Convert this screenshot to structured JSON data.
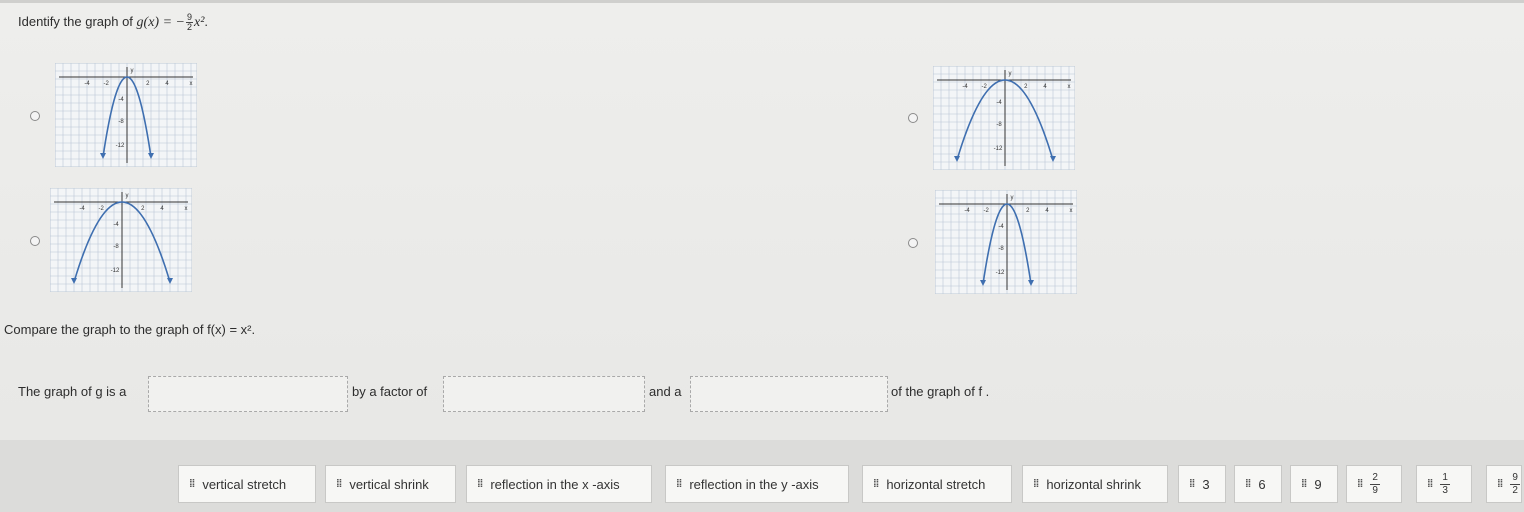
{
  "question1": {
    "prefix": "Identify the graph of ",
    "function_lhs": "g(x) = −",
    "coef_num": "9",
    "coef_den": "2",
    "var": "x²",
    "suffix": "."
  },
  "graph_tick_labels": {
    "x_neg4": "-4",
    "x_neg2": "-2",
    "x_2": "2",
    "x_4": "4",
    "y_neg4": "-4",
    "y_neg8": "-8",
    "y_neg12": "-12",
    "x_axis": "x",
    "y_axis": "y"
  },
  "question2": {
    "text": "Compare the graph to the graph of f(x) = x²."
  },
  "sentence": {
    "part1": "The graph of g is a",
    "part2": "by a factor of",
    "part3": "and a",
    "part4": "of the graph of f ."
  },
  "answer_bank": [
    {
      "label": "vertical stretch"
    },
    {
      "label": "vertical shrink"
    },
    {
      "label": "reflection in the x -axis"
    },
    {
      "label": "reflection in the y -axis"
    },
    {
      "label": "horizontal stretch"
    },
    {
      "label": "horizontal shrink"
    },
    {
      "label": "3"
    },
    {
      "label": "6"
    },
    {
      "label": "9"
    },
    {
      "num": "2",
      "den": "9"
    },
    {
      "num": "1",
      "den": "3"
    },
    {
      "num": "9",
      "den": "2"
    }
  ],
  "icons": {
    "grip": "drag-grip-icon",
    "radio": "radio-circle-icon"
  },
  "colors": {
    "curve": "#3f6fb0",
    "grid": "#b9c6d6",
    "page": "#eeeeec",
    "tile": "#f7f7f5"
  }
}
